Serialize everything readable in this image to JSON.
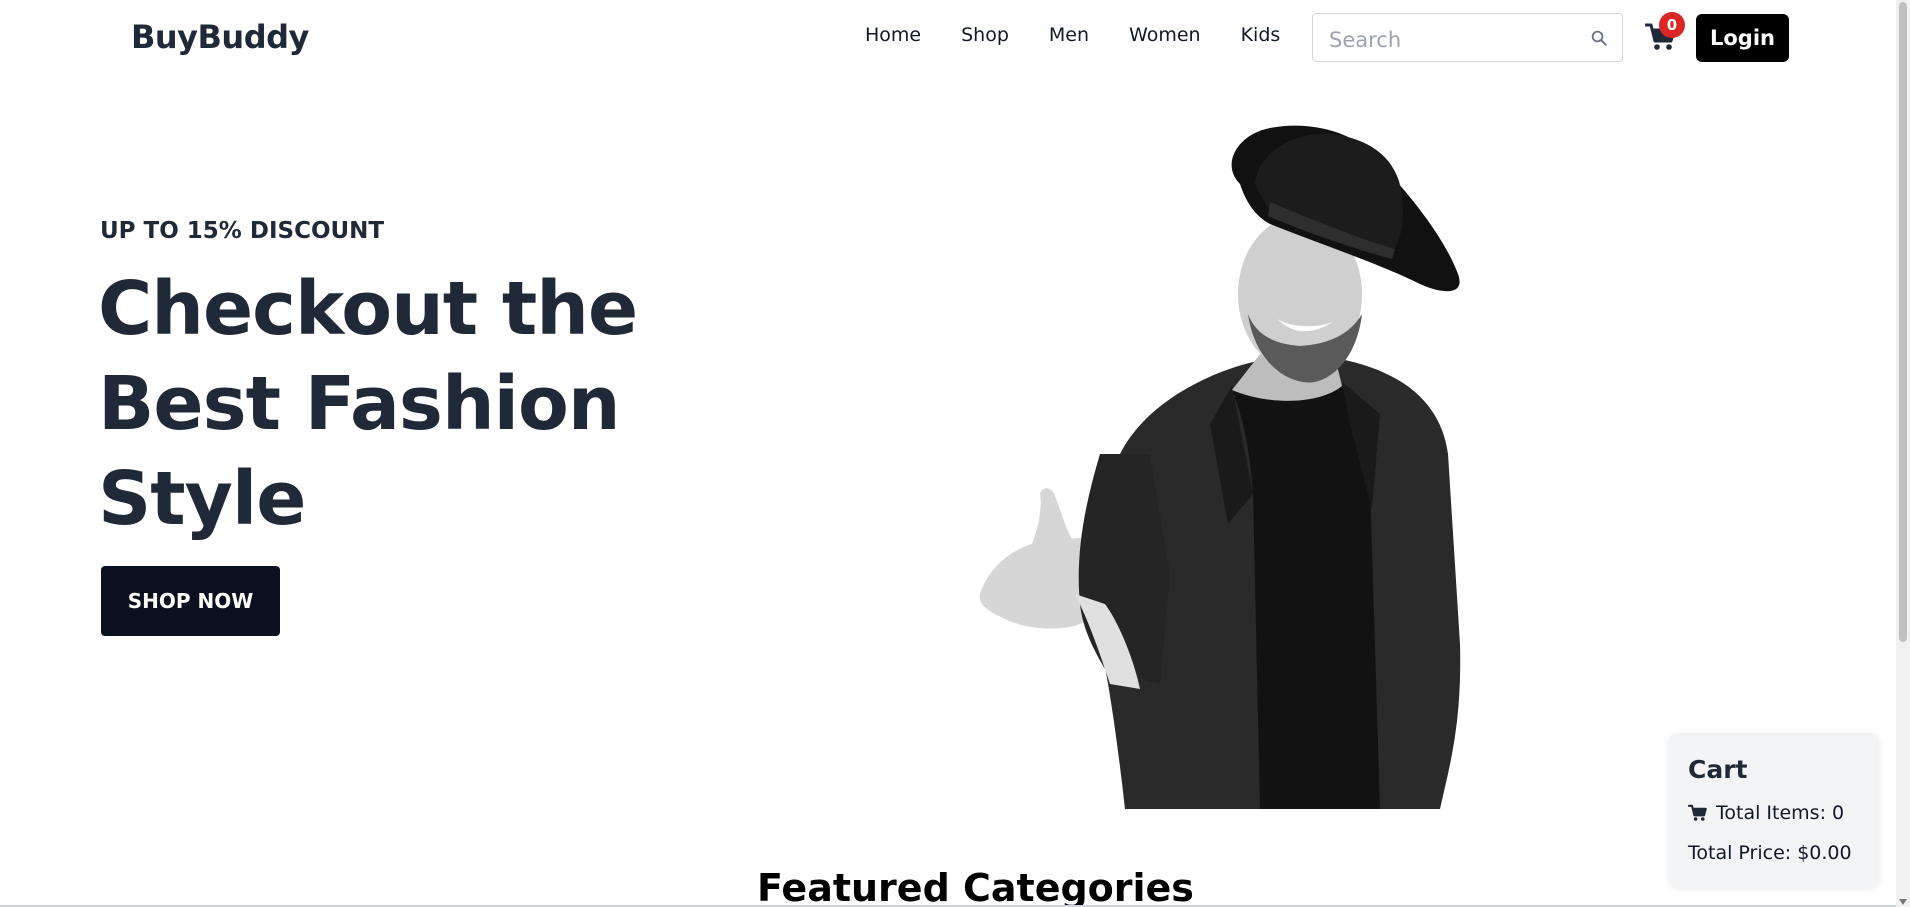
{
  "header": {
    "brand": "BuyBuddy",
    "nav": [
      "Home",
      "Shop",
      "Men",
      "Women",
      "Kids"
    ],
    "search_placeholder": "Search",
    "cart_count": "0",
    "login_label": "Login"
  },
  "hero": {
    "discount": "UP TO 15% DISCOUNT",
    "title": "Checkout the Best Fashion Style",
    "button_label": "SHOP NOW"
  },
  "sections": {
    "featured_title": "Featured Categories"
  },
  "cart_panel": {
    "title": "Cart",
    "total_items": "Total Items: 0",
    "total_price": "Total Price: $0.00"
  },
  "colors": {
    "primary_dark": "#1f2937",
    "button_dark": "#0b1020",
    "badge_red": "#dc2626",
    "login_black": "#000000"
  },
  "icons": {
    "search": "search-icon",
    "cart": "cart-icon",
    "hero_image": "fashion-model-image"
  }
}
